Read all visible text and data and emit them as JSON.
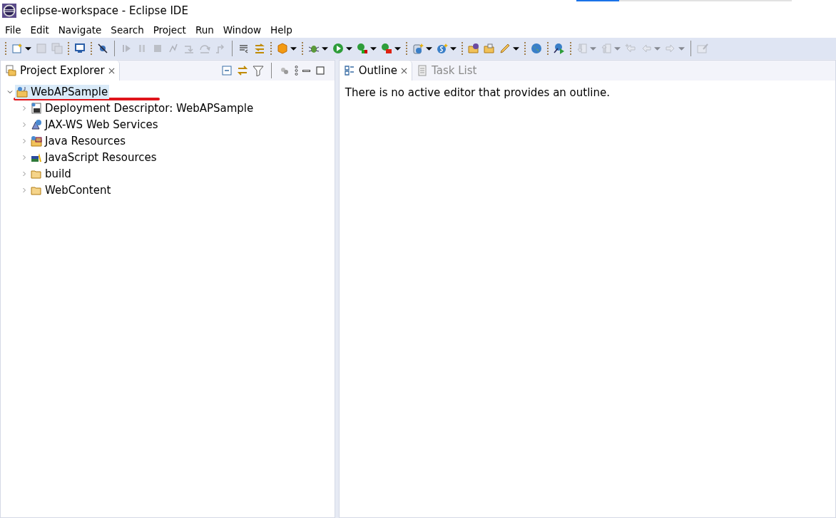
{
  "window": {
    "title": "eclipse-workspace - Eclipse IDE"
  },
  "top_progress": {
    "level": 0.2
  },
  "menu": [
    "File",
    "Edit",
    "Navigate",
    "Search",
    "Project",
    "Run",
    "Window",
    "Help"
  ],
  "toolbar": [
    {
      "kind": "grip"
    },
    {
      "kind": "newfile",
      "dropdown": true,
      "disabled": false
    },
    {
      "kind": "save",
      "dropdown": false,
      "disabled": true
    },
    {
      "kind": "saveall",
      "dropdown": false,
      "disabled": true
    },
    {
      "kind": "grip"
    },
    {
      "kind": "monitor",
      "dropdown": false,
      "disabled": false
    },
    {
      "kind": "grip"
    },
    {
      "kind": "nobreak",
      "dropdown": false,
      "disabled": false
    },
    {
      "kind": "rule"
    },
    {
      "kind": "resume",
      "dropdown": false,
      "disabled": true
    },
    {
      "kind": "pause",
      "dropdown": false,
      "disabled": true
    },
    {
      "kind": "stop",
      "dropdown": false,
      "disabled": true
    },
    {
      "kind": "disconnect",
      "dropdown": false,
      "disabled": true
    },
    {
      "kind": "stepinto",
      "dropdown": false,
      "disabled": true
    },
    {
      "kind": "stepover",
      "dropdown": false,
      "disabled": true
    },
    {
      "kind": "stepreturn",
      "dropdown": false,
      "disabled": true
    },
    {
      "kind": "rule"
    },
    {
      "kind": "lines",
      "dropdown": false,
      "disabled": false
    },
    {
      "kind": "filter",
      "dropdown": false,
      "disabled": false
    },
    {
      "kind": "grip"
    },
    {
      "kind": "cube",
      "dropdown": true,
      "disabled": false
    },
    {
      "kind": "grip"
    },
    {
      "kind": "bug",
      "dropdown": true,
      "disabled": false
    },
    {
      "kind": "run",
      "dropdown": true,
      "disabled": false
    },
    {
      "kind": "coverage",
      "dropdown": true,
      "disabled": false
    },
    {
      "kind": "tools",
      "dropdown": true,
      "disabled": false
    },
    {
      "kind": "grip"
    },
    {
      "kind": "server",
      "dropdown": true,
      "disabled": false
    },
    {
      "kind": "sbadge",
      "dropdown": true,
      "disabled": false
    },
    {
      "kind": "grip"
    },
    {
      "kind": "folderball",
      "dropdown": false,
      "disabled": false
    },
    {
      "kind": "folderbox",
      "dropdown": false,
      "disabled": false
    },
    {
      "kind": "pen",
      "dropdown": true,
      "disabled": false
    },
    {
      "kind": "grip"
    },
    {
      "kind": "globe",
      "dropdown": false,
      "disabled": false
    },
    {
      "kind": "grip"
    },
    {
      "kind": "runserver",
      "dropdown": false,
      "disabled": false
    },
    {
      "kind": "grip"
    },
    {
      "kind": "down",
      "dropdown": true,
      "disabled": true
    },
    {
      "kind": "up",
      "dropdown": true,
      "disabled": true
    },
    {
      "kind": "lastedit",
      "dropdown": false,
      "disabled": true
    },
    {
      "kind": "back",
      "dropdown": true,
      "disabled": true
    },
    {
      "kind": "forward",
      "dropdown": true,
      "disabled": true
    },
    {
      "kind": "rule"
    },
    {
      "kind": "pin",
      "dropdown": false,
      "disabled": true
    }
  ],
  "left_panel": {
    "tabs": [
      {
        "label": "Project Explorer",
        "selected": true
      }
    ],
    "tree": [
      {
        "label": "WebAPSample",
        "kind": "project",
        "expanded": true,
        "selected": true,
        "annotated": true,
        "children": [
          {
            "label": "Deployment Descriptor: WebAPSample",
            "kind": "descriptor",
            "expanded": false,
            "selected": false,
            "annotated": false
          },
          {
            "label": "JAX-WS Web Services",
            "kind": "webservice",
            "expanded": false,
            "selected": false,
            "annotated": false
          },
          {
            "label": "Java Resources",
            "kind": "javares",
            "expanded": false,
            "selected": false,
            "annotated": false
          },
          {
            "label": "JavaScript Resources",
            "kind": "jsres",
            "expanded": false,
            "selected": false,
            "annotated": false
          },
          {
            "label": "build",
            "kind": "folder",
            "expanded": false,
            "selected": false,
            "annotated": false
          },
          {
            "label": "WebContent",
            "kind": "folder",
            "expanded": false,
            "selected": false,
            "annotated": false
          }
        ]
      }
    ]
  },
  "right_panel": {
    "tabs": [
      {
        "label": "Outline",
        "selected": true
      },
      {
        "label": "Task List",
        "selected": false
      }
    ],
    "message": "There is no active editor that provides an outline."
  }
}
